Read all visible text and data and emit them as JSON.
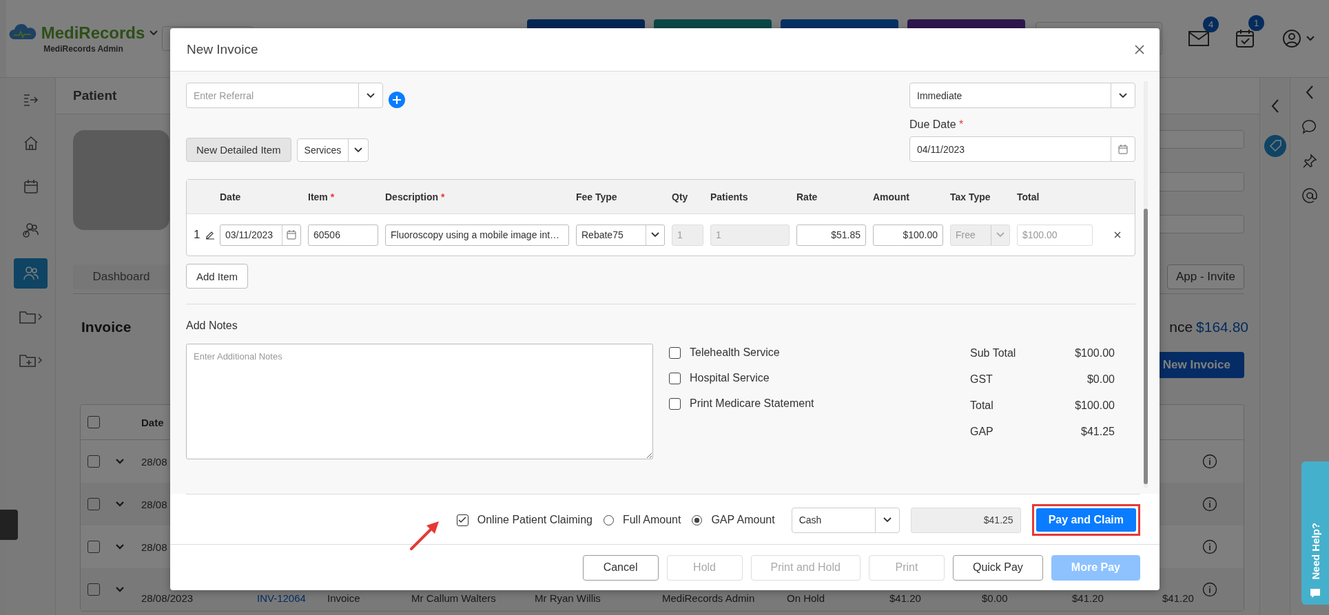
{
  "app": {
    "logo": "MediRecords",
    "role": "MediRecords Admin",
    "notifications": [
      {
        "kind": "mail",
        "count": "4"
      },
      {
        "kind": "calendar",
        "count": "1"
      }
    ],
    "nav": [
      {
        "kind": "collapse",
        "selected": false
      },
      {
        "kind": "home",
        "selected": false
      },
      {
        "kind": "calendar",
        "selected": false
      },
      {
        "kind": "billing",
        "selected": false
      },
      {
        "kind": "people",
        "selected": true
      },
      {
        "kind": "folder",
        "selected": false
      },
      {
        "kind": "folder-plus",
        "selected": false
      }
    ],
    "help": "Need Help?"
  },
  "page": {
    "title": "Patient",
    "tab": "Dashboard",
    "invite_button": "App - Invite",
    "section": "Invoice",
    "balance_label": "nce",
    "balance_value": "$164.80",
    "new_invoice_button": "New Invoice",
    "table": {
      "header_checked": false,
      "columns": [
        "Date"
      ],
      "rows": [
        {
          "checked": false,
          "cells": [
            "28/08"
          ]
        },
        {
          "checked": false,
          "cells": [
            "28/08"
          ]
        },
        {
          "checked": false,
          "cells": [
            "28/08"
          ]
        },
        {
          "checked": false,
          "cells": [
            "28/08/2023",
            "INV-12064",
            "Invoice",
            "Mr Callum Walters",
            "Mr Ryan Willis",
            "MediRecords Admin",
            "On Hold",
            "$41.20",
            "$0.00",
            "$41.20",
            "$41.20"
          ]
        }
      ]
    }
  },
  "modal": {
    "title": "New Invoice",
    "referral": {
      "placeholder": "Enter Referral"
    },
    "terms": {
      "value": "Immediate"
    },
    "due_date": {
      "label": "Due Date",
      "required_mark": "*",
      "value": "04/11/2023"
    },
    "new_item_button": "New Detailed Item",
    "category": {
      "value": "Services"
    },
    "items": {
      "columns": [
        {
          "label": "Date"
        },
        {
          "label": "Item",
          "required_mark": "*"
        },
        {
          "label": "Description",
          "required_mark": "*"
        },
        {
          "label": "Fee Type"
        },
        {
          "label": "Qty"
        },
        {
          "label": "Patients"
        },
        {
          "label": "Rate"
        },
        {
          "label": "Amount"
        },
        {
          "label": "Tax Type"
        },
        {
          "label": "Total"
        }
      ],
      "rows": [
        {
          "number": "1",
          "date": "03/11/2023",
          "item": "60506",
          "description": "Fluoroscopy using a mobile image int…",
          "fee_type": "Rebate75",
          "qty": "1",
          "patients": "1",
          "rate": "$51.85",
          "amount": "$100.00",
          "tax_type": "Free",
          "total": "$100.00"
        }
      ]
    },
    "add_item_button": "Add Item",
    "notes": {
      "label": "Add Notes",
      "placeholder": "Enter Additional Notes"
    },
    "options": [
      {
        "label": "Telehealth Service",
        "checked": false
      },
      {
        "label": "Hospital Service",
        "checked": false
      },
      {
        "label": "Print Medicare Statement",
        "checked": false
      }
    ],
    "totals": [
      {
        "label": "Sub Total",
        "value": "$100.00"
      },
      {
        "label": "GST",
        "value": "$0.00"
      },
      {
        "label": "Total",
        "value": "$100.00"
      },
      {
        "label": "GAP",
        "value": "$41.25"
      }
    ],
    "claim": {
      "online": {
        "label": "Online Patient Claiming",
        "checked": true,
        "pointed": true
      },
      "amount_options": [
        {
          "label": "Full Amount",
          "selected": false
        },
        {
          "label": "GAP Amount",
          "selected": true
        }
      ],
      "method": {
        "value": "Cash"
      },
      "amount": {
        "value": "$41.25"
      },
      "submit": {
        "label": "Pay and Claim",
        "highlighted": true
      }
    },
    "buttons": [
      {
        "label": "Cancel",
        "kind": "default",
        "disabled": false
      },
      {
        "label": "Hold",
        "kind": "default",
        "disabled": true
      },
      {
        "label": "Print and Hold",
        "kind": "default",
        "disabled": true
      },
      {
        "label": "Print",
        "kind": "default",
        "disabled": true
      },
      {
        "label": "Quick Pay",
        "kind": "default",
        "disabled": false
      },
      {
        "label": "More Pay",
        "kind": "primary",
        "disabled": true
      }
    ]
  }
}
